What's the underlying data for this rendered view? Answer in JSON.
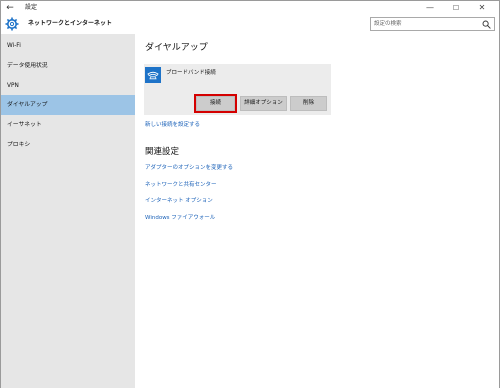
{
  "titlebar": {
    "back_glyph": "←",
    "title": "設定",
    "minimize_glyph": "—",
    "maximize_glyph": "☐",
    "close_glyph": "✕"
  },
  "header": {
    "title": "ネットワークとインターネット",
    "search_placeholder": "設定の検索"
  },
  "sidebar": {
    "items": [
      {
        "label": "Wi-Fi"
      },
      {
        "label": "データ使用状況"
      },
      {
        "label": "VPN"
      },
      {
        "label": "ダイヤルアップ"
      },
      {
        "label": "イーサネット"
      },
      {
        "label": "プロキシ"
      }
    ],
    "selected_index": 3
  },
  "main": {
    "dialup_heading": "ダイヤルアップ",
    "connection": {
      "name": "ブロードバンド接続",
      "connect_label": "接続",
      "advanced_label": "詳細オプション",
      "delete_label": "削除"
    },
    "new_connection_link": "新しい接続を設定する",
    "related_heading": "関連設定",
    "related_links": [
      "アダプターのオプションを変更する",
      "ネットワークと共有センター",
      "インターネット オプション",
      "Windows ファイアウォール"
    ]
  },
  "colors": {
    "accent": "#1e73c8",
    "selected_bg": "#9cc4e6",
    "sidebar_bg": "#e6e6e6",
    "link": "#1a61b8",
    "highlight_border": "#d40000"
  }
}
